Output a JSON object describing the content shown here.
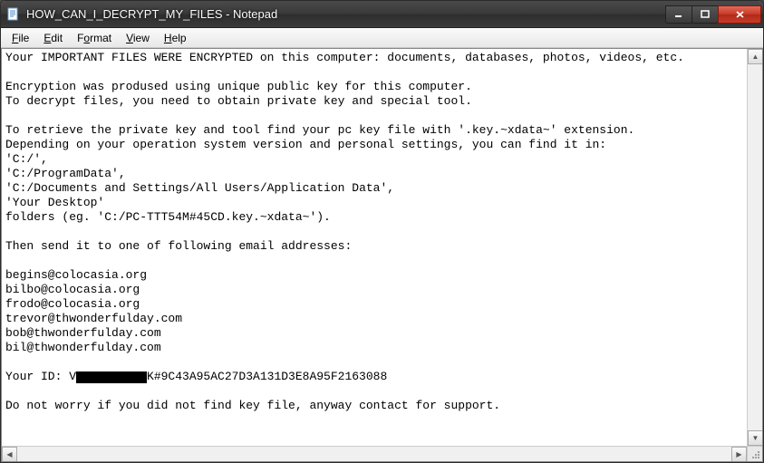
{
  "window": {
    "title": "HOW_CAN_I_DECRYPT_MY_FILES - Notepad"
  },
  "menu": {
    "file": "File",
    "edit": "Edit",
    "format": "Format",
    "view": "View",
    "help": "Help"
  },
  "body": {
    "line1": "Your IMPORTANT FILES WERE ENCRYPTED on this computer: documents, databases, photos, videos, etc.",
    "line2": "",
    "line3": "Encryption was prodused using unique public key for this computer.",
    "line4": "To decrypt files, you need to obtain private key and special tool.",
    "line5": "",
    "line6": "To retrieve the private key and tool find your pc key file with '.key.~xdata~' extension.",
    "line7": "Depending on your operation system version and personal settings, you can find it in:",
    "line8": "'C:/',",
    "line9": "'C:/ProgramData',",
    "line10": "'C:/Documents and Settings/All Users/Application Data',",
    "line11": "'Your Desktop'",
    "line12": "folders (eg. 'C:/PC-TTT54M#45CD.key.~xdata~').",
    "line13": "",
    "line14": "Then send it to one of following email addresses:",
    "line15": "",
    "line16": "begins@colocasia.org",
    "line17": "bilbo@colocasia.org",
    "line18": "frodo@colocasia.org",
    "line19": "trevor@thwonderfulday.com",
    "line20": "bob@thwonderfulday.com",
    "line21": "bil@thwonderfulday.com",
    "line22": "",
    "id_prefix": "Your ID: V",
    "id_suffix": "K#9C43A95AC27D3A131D3E8A95F2163088",
    "line24": "",
    "line25": "Do not worry if you did not find key file, anyway contact for support."
  }
}
